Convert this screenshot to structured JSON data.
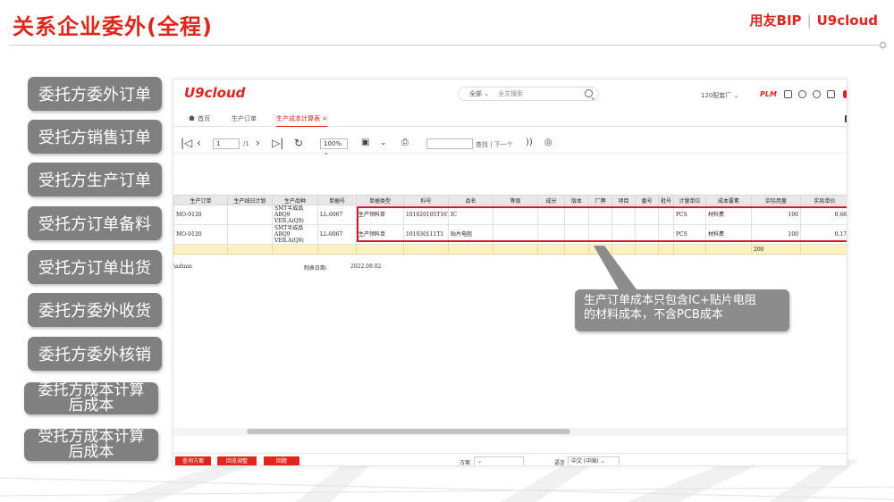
{
  "slide": {
    "title": "关系企业委外(全程)",
    "brand_left": "用友BIP",
    "brand_right": "U9cloud"
  },
  "sidebar": {
    "items": [
      {
        "label": "委托方委外订单"
      },
      {
        "label": "受托方销售订单"
      },
      {
        "label": "受托方生产订单"
      },
      {
        "label": "受托方订单备料"
      },
      {
        "label": "受托方订单出货"
      },
      {
        "label": "委托方委外收货"
      },
      {
        "label": "委托方委外核销"
      },
      {
        "label": "委托方成本计算",
        "label2": "后成本"
      },
      {
        "label": "受托方成本计算",
        "label2": "后成本"
      }
    ]
  },
  "app": {
    "logo": "U9cloud",
    "search": {
      "scope": "全部",
      "placeholder": "全文搜索"
    },
    "org": "120配套厂",
    "plm": "PLM",
    "tabs": [
      {
        "label": "首页"
      },
      {
        "label": "生产订单"
      },
      {
        "label": "生产成本计算表",
        "close": "×"
      }
    ],
    "pager": {
      "page": "1",
      "total": "/1"
    },
    "zoom": "100%",
    "find_label": "查找 | 下一个",
    "table": {
      "headers": [
        "生产订单",
        "生产线日计划",
        "生产品种",
        "单据号",
        "单据类型",
        "料号",
        "品名",
        "等级",
        "成分",
        "版本",
        "厂牌",
        "项目",
        "番号",
        "批号",
        "计量单位",
        "成本要素",
        "实际用量",
        "实际单价"
      ],
      "rows": [
        [
          "MO-0120",
          "",
          "SMT半成品 ABQ9 VER.A(Q9)",
          "LL-0067",
          "生产领料单",
          "101020105T167",
          "IC",
          "",
          "",
          "",
          "",
          "",
          "",
          "",
          "PCS",
          "材料费",
          "100",
          "0.68"
        ],
        [
          "MO-0120",
          "",
          "SMT半成品 ABQ9 VER.A(Q9)",
          "LL-0067",
          "生产领料单",
          "101030111T1",
          "贴片电阻",
          "",
          "",
          "",
          "",
          "",
          "",
          "",
          "PCS",
          "材料费",
          "100",
          "0.17"
        ]
      ],
      "total_row": {
        "qty": "200"
      }
    },
    "footer": {
      "user": "\\admin",
      "date_label": "制表日期:",
      "date": "2022.08.02"
    },
    "bottom": {
      "buttons": [
        "查询方案",
        "回览调整",
        "回题"
      ],
      "scheme_label": "方案",
      "language_label": "语言",
      "language_value": "中文 (中国)"
    }
  },
  "callout": {
    "line1": "生产订单成本只包含IC+贴片电阻",
    "line2": "的材料成本，不含PCB成本"
  },
  "colors": {
    "accent": "#e0261c",
    "sidebar_button": "#808080",
    "highlight_border": "#d0192a",
    "total_row": "#fdf0c2"
  }
}
